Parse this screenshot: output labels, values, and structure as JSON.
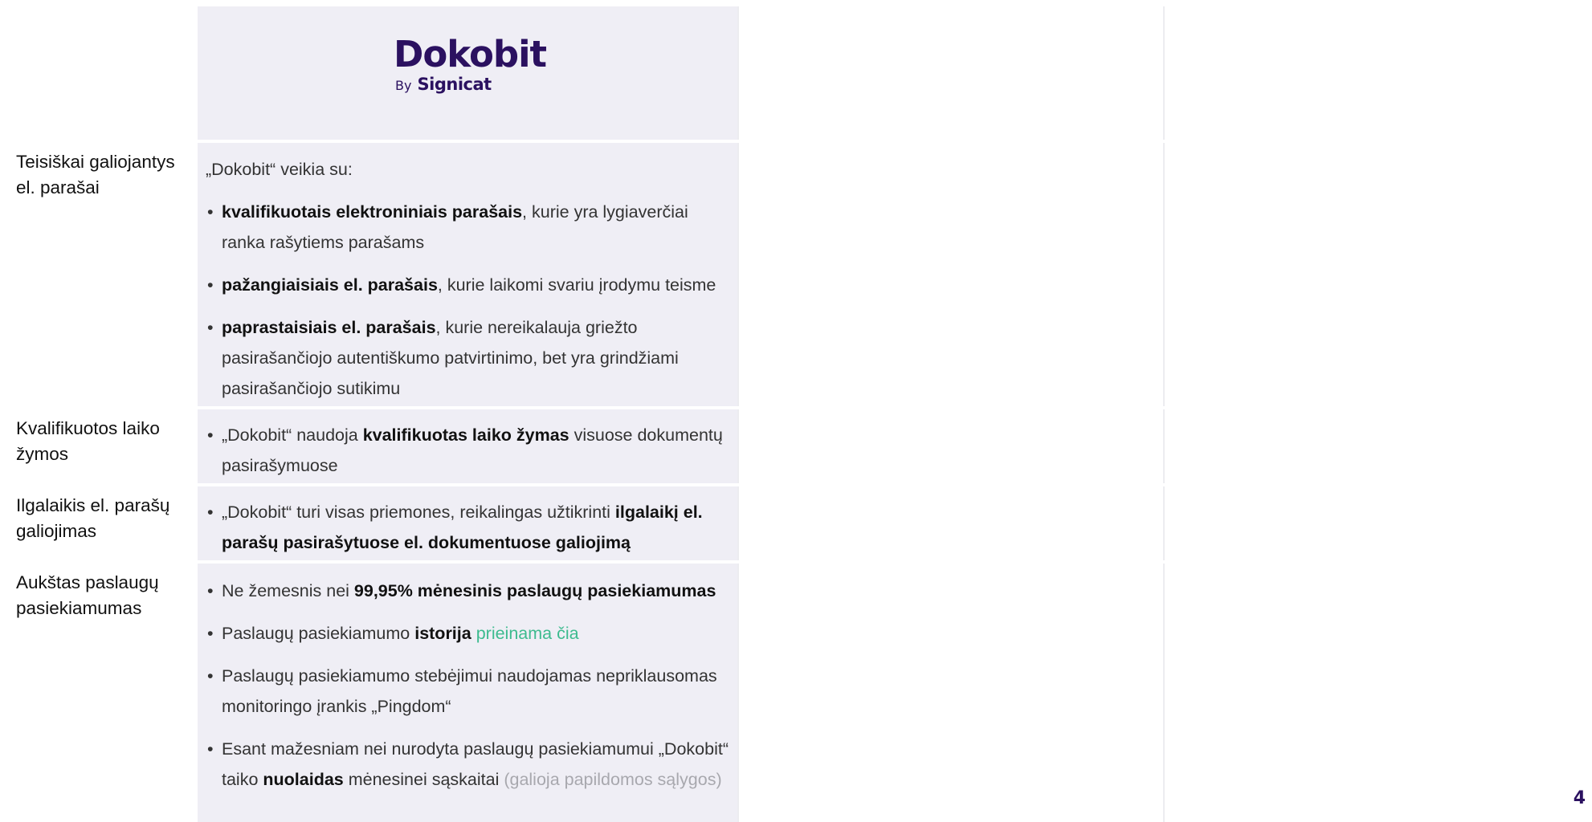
{
  "logo": {
    "main": "Dokobit",
    "by": "By",
    "brand": "Signicat"
  },
  "colors": {
    "brand": "#2b1160",
    "link": "#3dbb8f",
    "column_bg": "#efeef5",
    "muted": "#a8a8ae"
  },
  "rows": [
    {
      "label": "Teisiškai galiojantys el. parašai",
      "intro": "„Dokobit“ veikia su:",
      "bullets": [
        {
          "bold": "kvalifikuotais elektroniniais parašais",
          "rest": ", kurie yra lygiaverčiai ranka rašytiems parašams"
        },
        {
          "bold": "pažangiaisiais el. parašais",
          "rest": ", kurie laikomi svariu įrodymu teisme"
        },
        {
          "bold": "paprastaisiais el. parašais",
          "rest": ", kurie nereikalauja griežto pasirašančiojo autentiškumo patvirtinimo, bet yra grindžiami pasirašančiojo sutikimu"
        }
      ]
    },
    {
      "label": "Kvalifikuotos laiko žymos",
      "bullets": [
        {
          "pre": "„Dokobit“ naudoja ",
          "bold": "kvalifikuotas laiko žymas",
          "rest": " visuose dokumentų pasirašymuose"
        }
      ]
    },
    {
      "label": "Ilgalaikis el. parašų galiojimas",
      "bullets": [
        {
          "pre": "„Dokobit“ turi visas priemones, reikalingas užtikrinti ",
          "bold": "ilgalaikį el. parašų pasirašytuose el. dokumentuose galiojimą"
        }
      ]
    },
    {
      "label": "Aukštas paslaugų pasiekiamumas",
      "bullets": [
        {
          "pre": "Ne žemesnis nei ",
          "bold": "99,95% mėnesinis paslaugų pasiekiamumas"
        },
        {
          "pre": "Paslaugų pasiekiamumo ",
          "bold": "istorija",
          "link": "prieinama čia"
        },
        {
          "pre": "Paslaugų pasiekiamumo stebėjimui naudojamas nepriklausomas monitoringo įrankis „Pingdom“"
        },
        {
          "pre": "Esant mažesniam nei nurodyta paslaugų pasiekiamumui „Dokobit“ taiko ",
          "bold": "nuolaidas",
          "rest": " mėnesinei sąskaitai ",
          "muted": "(galioja papildomos sąlygos)"
        }
      ]
    }
  ],
  "page_number": "4"
}
